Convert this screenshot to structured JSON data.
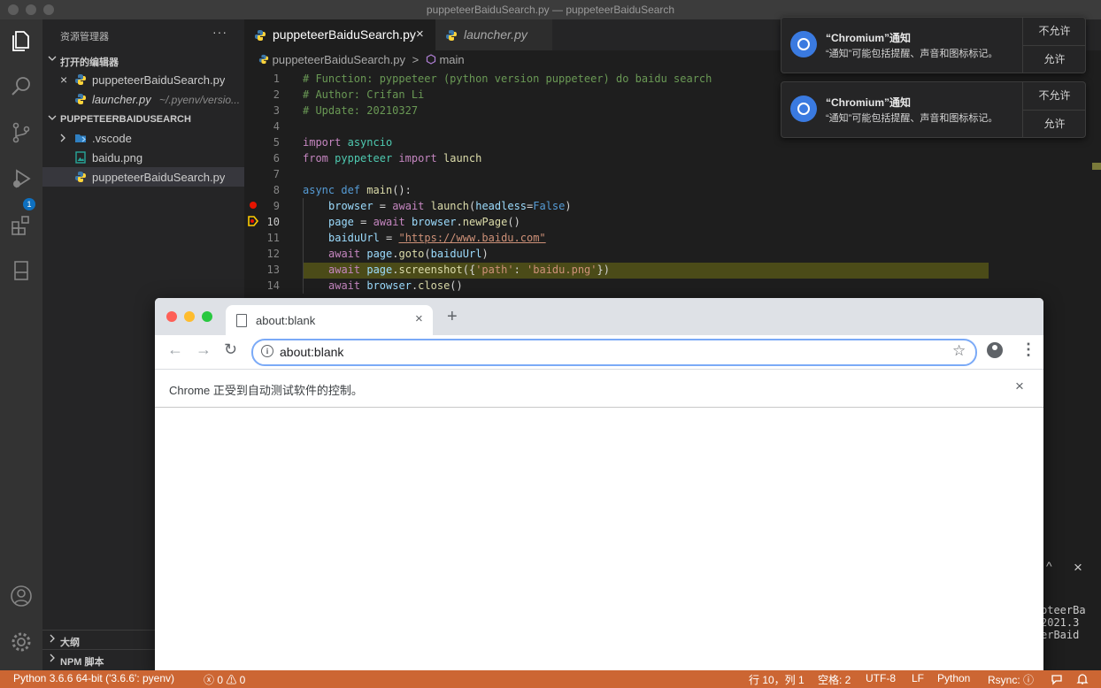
{
  "window": {
    "title": "puppeteerBaiduSearch.py — puppeteerBaiduSearch"
  },
  "sidebar": {
    "title": "资源管理器",
    "more": "···",
    "open_editors": {
      "header": "打开的编辑器",
      "items": [
        {
          "name": "puppeteerBaiduSearch.py",
          "path": ""
        },
        {
          "name": "launcher.py",
          "path": "~/.pyenv/versio..."
        }
      ]
    },
    "project": {
      "header": "PUPPETEERBAIDUSEARCH",
      "items": [
        {
          "name": ".vscode"
        },
        {
          "name": "baidu.png"
        },
        {
          "name": "puppeteerBaiduSearch.py"
        }
      ]
    },
    "outline": "大纲",
    "npm": "NPM 脚本"
  },
  "activity": {
    "debug_badge": "1"
  },
  "tabs": [
    {
      "label": "puppeteerBaiduSearch.py",
      "close": "×"
    },
    {
      "label": "launcher.py"
    }
  ],
  "breadcrumb": {
    "file": "puppeteerBaiduSearch.py",
    "sep": ">",
    "symbol": "main"
  },
  "code": {
    "line_numbers": [
      "1",
      "2",
      "3",
      "4",
      "5",
      "6",
      "7",
      "8",
      "9",
      "10",
      "11",
      "12",
      "13",
      "14"
    ],
    "l1": "# Function: pyppeteer (python version puppeteer) do baidu search",
    "l2": "# Author: Crifan Li",
    "l3": "# Update: 20210327",
    "l5_kw": "import",
    "l5_mod": "asyncio",
    "l6_kw": "from",
    "l6_mod": "pyppeteer",
    "l6_kw2": "import",
    "l6_fn": "launch",
    "l8_kw": "async",
    "l8_kw2": "def",
    "l8_fn": "main",
    "l8_rest": "():",
    "l9_var": "browser",
    "l9_eq": " = ",
    "l9_kw": "await",
    "l9_fn": "launch",
    "l9_p": "(",
    "l9_arg": "headless",
    "l9_eq2": "=",
    "l9_val": "False",
    "l9_end": ")",
    "l10_var": "page",
    "l10_eq": " = ",
    "l10_kw": "await",
    "l10_obj": "browser",
    "l10_dot": ".",
    "l10_fn": "newPage",
    "l10_end": "()",
    "l11_var": "baiduUrl",
    "l11_eq": " = ",
    "l11_str": "\"https://www.baidu.com\"",
    "l12_kw": "await",
    "l12_obj": "page",
    "l12_dot": ".",
    "l12_fn": "goto",
    "l12_p": "(",
    "l12_arg": "baiduUrl",
    "l12_end": ")",
    "l13_kw": "await",
    "l13_obj": "page",
    "l13_dot": ".",
    "l13_fn": "screenshot",
    "l13_p": "({",
    "l13_s1": "'path'",
    "l13_c": ": ",
    "l13_s2": "'baidu.png'",
    "l13_end": "})",
    "l14_kw": "await",
    "l14_obj": "browser",
    "l14_dot": ".",
    "l14_fn": "close",
    "l14_end": "()"
  },
  "notifications": [
    {
      "title": "“Chromium”通知",
      "body": "“通知”可能包括提醒、声音和图标标记。",
      "deny": "不允许",
      "allow": "允许"
    },
    {
      "title": "“Chromium”通知",
      "body": "“通知”可能包括提醒、声音和图标标记。",
      "deny": "不允许",
      "allow": "允许"
    }
  ],
  "terminal": {
    "lines": [
      "pteerBa",
      "2021.3",
      "erBaid"
    ],
    "collapse": "^",
    "close": "×"
  },
  "chrome": {
    "tab_title": "about:blank",
    "tab_close": "×",
    "new_tab": "+",
    "back": "←",
    "forward": "→",
    "reload": "↻",
    "url": "about:blank",
    "star": "☆",
    "menu": "⋮",
    "info_bar": "Chrome 正受到自动测试软件的控制。",
    "info_close": "×"
  },
  "statusbar": {
    "python": "Python 3.6.6 64-bit ('3.6.6': pyenv)",
    "problems": "ⓧ 0 ⚠ 0",
    "position": "行 10，列 1",
    "spaces": "空格: 2",
    "encoding": "UTF-8",
    "eol": "LF",
    "language": "Python",
    "rsync": "Rsync: ⓘ"
  },
  "colors": {
    "status_bar": "#cc6633",
    "highlight_line": "#4b4b18",
    "breakpoint": "#e51400",
    "focus_ring": "#7baaf7"
  }
}
